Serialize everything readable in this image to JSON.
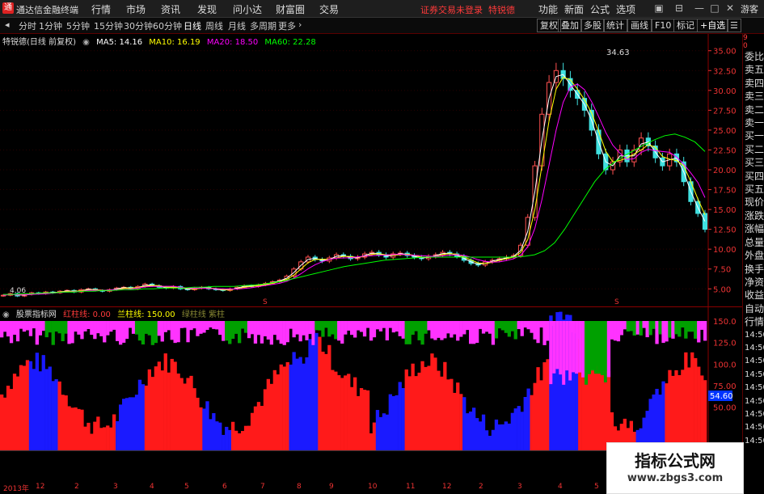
{
  "titlebar": {
    "app_name": "通达信金融终端",
    "menus": [
      "行情",
      "市场",
      "资讯",
      "发现",
      "问小达",
      "财富圈",
      "交易"
    ],
    "alert": "证券交易未登录",
    "stock_name": "特锐德",
    "right_menus": [
      "功能",
      "新面",
      "公式",
      "选项"
    ],
    "guest": "游客"
  },
  "toolbar": {
    "periods": [
      "分时",
      "1分钟",
      "5分钟",
      "15分钟",
      "30分钟",
      "60分钟",
      "日线",
      "周线",
      "月线",
      "多周期",
      "更多"
    ],
    "right_buttons": [
      "复权",
      "叠加",
      "多股",
      "统计",
      "画线",
      "F10",
      "标记",
      "+自选"
    ]
  },
  "main_indicator": {
    "title": "特锐德(日线 前复权)",
    "ma5": "MA5: 14.16",
    "ma10": "MA10: 16.19",
    "ma20": "MA20: 18.50",
    "ma60": "MA60: 22.28",
    "peak_label": "34.63",
    "low_label": "4.06",
    "colors": {
      "ma5": "#ffffff",
      "ma10": "#ffff00",
      "ma20": "#ff00ff",
      "ma60": "#00ff00"
    }
  },
  "price_axis": [
    "35.00",
    "32.50",
    "30.00",
    "27.50",
    "25.00",
    "22.50",
    "20.00",
    "17.50",
    "15.00",
    "12.50",
    "10.00",
    "7.50",
    "5.00"
  ],
  "sub_indicator": {
    "title": "股票指标网",
    "red_line": "红柱线: 0.00",
    "blue_line": "兰柱线: 150.00",
    "extra": "绿柱线 紫柱",
    "axis": [
      "150.0",
      "125.0",
      "100.0",
      "75.00",
      "50.00"
    ],
    "current": "54.60"
  },
  "right_panel": {
    "top_red": [
      "9",
      "0"
    ],
    "items": [
      "委比",
      "卖五",
      "卖四",
      "卖三",
      "卖二",
      "卖一",
      "买一",
      "买二",
      "买三",
      "买四",
      "买五",
      "现价",
      "涨跌",
      "涨幅",
      "总量",
      "外盘",
      "换手",
      "净资",
      "收益",
      "自动",
      "行情",
      "14:50",
      "14:50",
      "14:50",
      "14:50",
      "14:50",
      "14:50",
      "14:50",
      "14:50",
      "14:50"
    ]
  },
  "dates": [
    "2013年",
    "12",
    "2",
    "3",
    "4",
    "5",
    "6",
    "7",
    "8",
    "9",
    "10",
    "11",
    "12",
    "2",
    "3",
    "4",
    "5",
    "6"
  ],
  "watermark": {
    "line1": "指标公式网",
    "line2": "www.zbgs3.com"
  },
  "chart_data": {
    "type": "candlestick",
    "title": "特锐德(日线 前复权)",
    "ylim": [
      3.5,
      36.5
    ],
    "close": [
      4.2,
      4.4,
      4.1,
      4.3,
      4.5,
      4.4,
      4.6,
      4.5,
      4.7,
      4.8,
      4.6,
      4.9,
      5.0,
      4.8,
      4.7,
      4.9,
      5.1,
      5.2,
      5.0,
      5.3,
      5.6,
      5.4,
      5.2,
      5.1,
      5.3,
      5.0,
      4.9,
      5.1,
      5.2,
      5.0,
      4.9,
      4.8,
      5.0,
      5.2,
      5.4,
      5.3,
      5.5,
      5.7,
      5.9,
      6.1,
      6.6,
      7.5,
      8.4,
      9.0,
      8.7,
      8.5,
      8.9,
      9.3,
      9.1,
      8.8,
      9.0,
      9.4,
      9.6,
      9.3,
      9.0,
      9.4,
      9.5,
      9.2,
      9.0,
      8.8,
      9.1,
      9.3,
      9.6,
      9.4,
      9.1,
      8.6,
      8.2,
      8.0,
      8.4,
      8.6,
      8.8,
      9.0,
      9.2,
      10.5,
      14.0,
      20.5,
      27.0,
      31.0,
      32.5,
      31.5,
      30.0,
      29.0,
      27.5,
      25.0,
      22.0,
      20.0,
      21.0,
      22.5,
      21.0,
      22.5,
      24.0,
      23.0,
      21.5,
      20.5,
      22.0,
      21.0,
      18.5,
      16.0,
      14.5,
      12.5
    ],
    "ma60": [
      4.3,
      4.3,
      4.4,
      4.4,
      4.5,
      4.5,
      4.6,
      4.6,
      4.7,
      4.7,
      4.8,
      4.8,
      4.9,
      4.9,
      5.0,
      5.0,
      5.1,
      5.1,
      5.1,
      5.2,
      5.2,
      5.3,
      5.3,
      5.3,
      5.4,
      5.5,
      5.6,
      5.8,
      6.0,
      6.3,
      6.6,
      6.9,
      7.2,
      7.5,
      7.8,
      8.0,
      8.2,
      8.4,
      8.6,
      8.7,
      8.8,
      8.9,
      9.0,
      9.0,
      9.0,
      9.0,
      9.0,
      9.0,
      9.0,
      9.0,
      9.0,
      9.0,
      9.1,
      9.3,
      9.8,
      10.8,
      12.5,
      14.5,
      16.5,
      18.5,
      20.0,
      21.0,
      21.8,
      22.5,
      23.2,
      23.8,
      24.3,
      24.5,
      24.1,
      23.5,
      22.3
    ]
  }
}
